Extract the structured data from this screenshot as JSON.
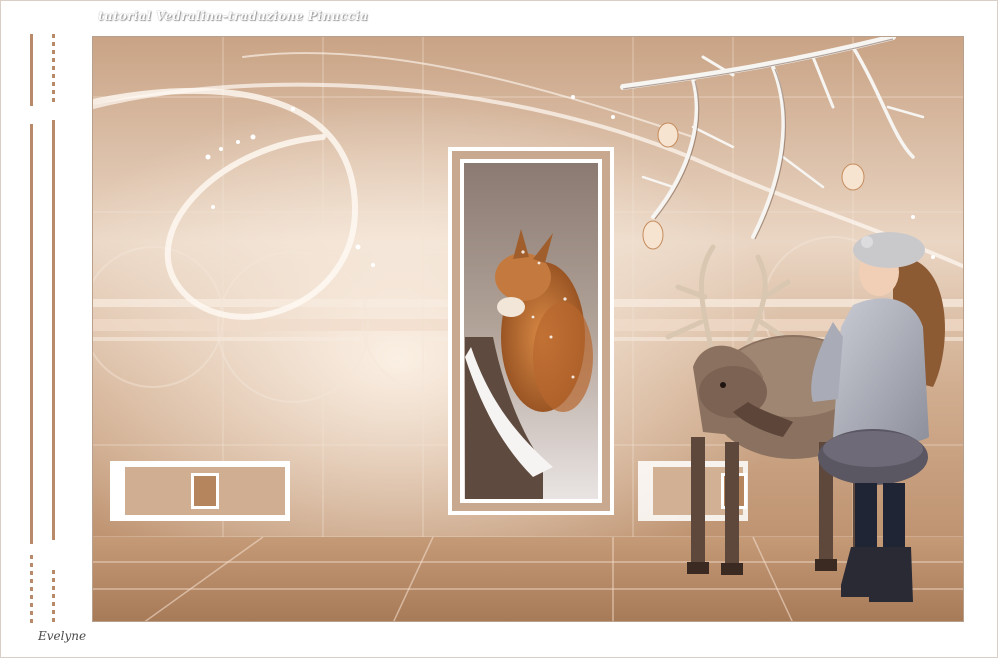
{
  "watermark": {
    "text": "tutorial Vedralina-traduzione Pinuccia"
  },
  "signature": {
    "text": "Evelyne"
  },
  "colors": {
    "frame_border": "#d9cfc6",
    "accent_brown": "#b98a6a",
    "art_base_light": "#ddc0a8",
    "art_base_dark": "#b88a66"
  },
  "scene": {
    "subjects": [
      "squirrel-in-snow",
      "reindeer",
      "girl-in-winter-coat",
      "snowy-branch"
    ]
  }
}
